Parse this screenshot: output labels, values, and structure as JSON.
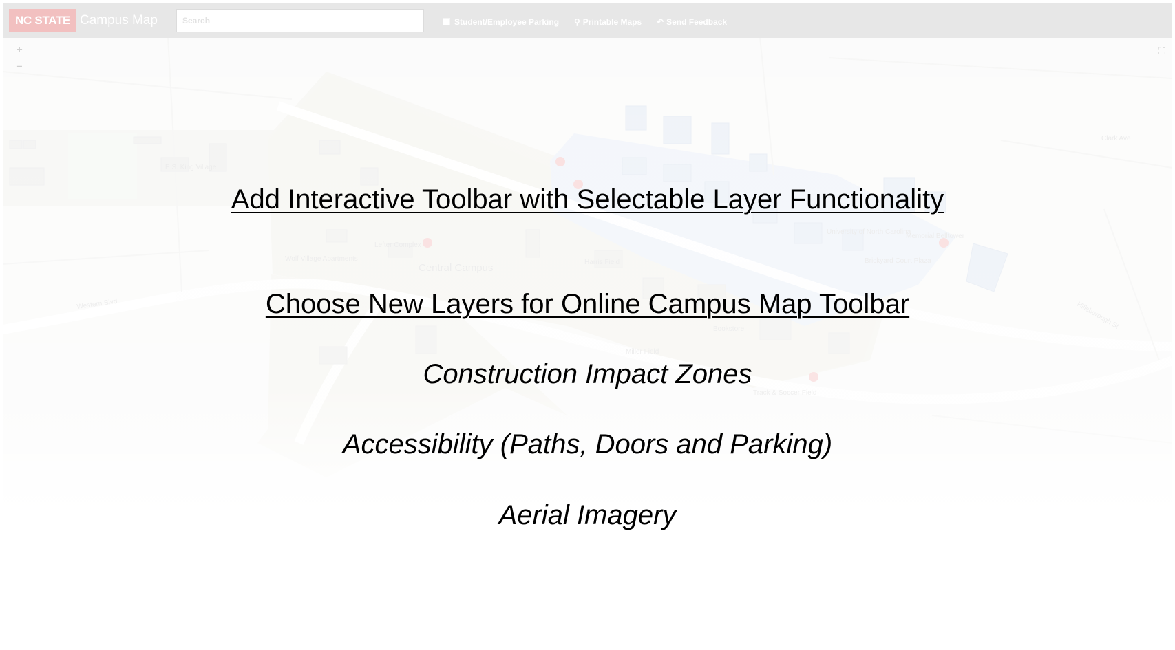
{
  "header": {
    "logo_text": "NC STATE",
    "title": "Campus Map",
    "search_placeholder": "Search",
    "nav": [
      {
        "label": "Student/Employee Parking",
        "icon": "checkbox-icon"
      },
      {
        "label": "Printable Maps",
        "icon": "map-pin-icon"
      },
      {
        "label": "Send Feedback",
        "icon": "reply-arrow-icon"
      }
    ]
  },
  "map_controls": {
    "zoom_in": "+",
    "zoom_out": "−",
    "fullscreen_icon": "fullscreen-icon"
  },
  "map_labels": [
    "E.S. King Village",
    "Lefter Complex",
    "Wolf Village Apartments",
    "Central Campus",
    "Harris Field",
    "Bookstore",
    "Miller Field",
    "Western Blvd",
    "Hillsborough St",
    "Clark Ave",
    "Memorial Belltower",
    "University of North Carolina",
    "Track & Soccer Field",
    "Brickyard Court Plaza"
  ],
  "slide": {
    "heading_1": "Add Interactive Toolbar with Selectable Layer Functionality",
    "heading_2": "Choose New Layers for Online Campus Map Toolbar",
    "items": [
      "Construction Impact Zones",
      "Accessibility (Paths, Doors and Parking)",
      "Aerial Imagery"
    ]
  },
  "colors": {
    "topbar": "#e7e7e7",
    "brand_red": "#f2c0c0",
    "campus_blue": "#dde7f5",
    "campus_tan": "#efeee6",
    "poi_red": "#f0a5a5"
  }
}
